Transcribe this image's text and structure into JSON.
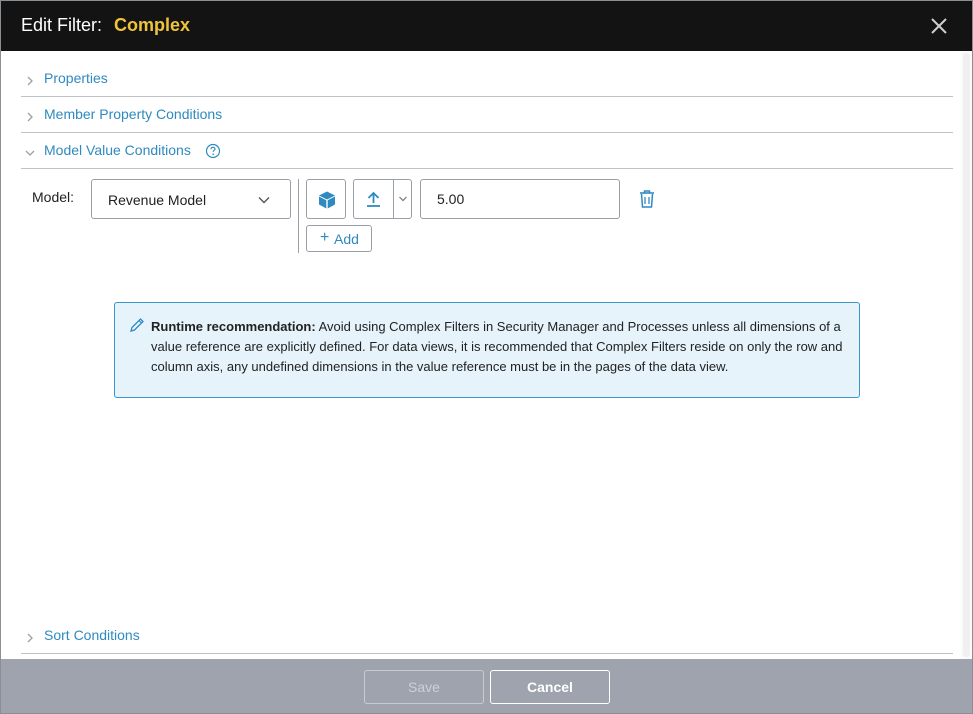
{
  "header": {
    "title_prefix": "Edit Filter:",
    "filter_name": "Complex",
    "close_icon": "close-icon"
  },
  "sections": {
    "properties": {
      "label": "Properties",
      "expanded": false
    },
    "member_property_conditions": {
      "label": "Member Property Conditions",
      "expanded": false
    },
    "model_value_conditions": {
      "label": "Model Value Conditions",
      "expanded": true,
      "help_icon": "help-circle-icon"
    },
    "sort_conditions": {
      "label": "Sort Conditions",
      "expanded": false
    }
  },
  "model_row": {
    "label": "Model:",
    "selected_model": "Revenue Model",
    "value": "5.00",
    "add_label": "+ Add",
    "add_text": "Add",
    "add_plus": "+",
    "icons": [
      "cube-icon",
      "upload-arrow-icon",
      "chevron-down-icon",
      "trash-icon"
    ]
  },
  "info": {
    "heading": "Runtime recommendation:",
    "body": " Avoid using Complex Filters in Security Manager and Processes unless all dimensions of a value reference are explicitly defined. For data views, it is recommended that Complex Filters reside on only the row and column axis, any undefined dimensions in the value reference must be in the pages of the data view.",
    "icon": "pencil-icon"
  },
  "footer": {
    "save_label": "Save",
    "cancel_label": "Cancel"
  },
  "colors": {
    "header_bg": "#131313",
    "title_accent": "#f0c43a",
    "link_blue": "#2f8ac0",
    "info_bg": "#e6f3fb",
    "info_border": "#3a94c9",
    "footer_bg": "#9ea3ae"
  }
}
